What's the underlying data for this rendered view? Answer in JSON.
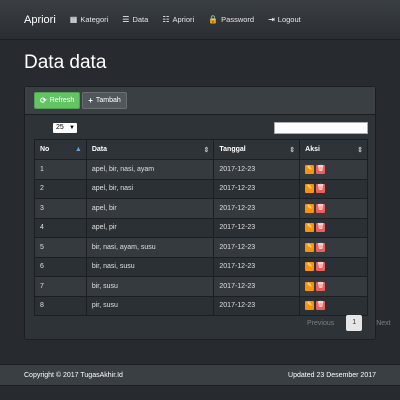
{
  "navbar": {
    "brand": "Apriori",
    "items": [
      {
        "label": "Kategori",
        "icon": "th-large-icon",
        "glyph": "▦"
      },
      {
        "label": "Data",
        "icon": "list-icon",
        "glyph": "☰"
      },
      {
        "label": "Apriori",
        "icon": "th-list-icon",
        "glyph": "☷"
      },
      {
        "label": "Password",
        "icon": "lock-icon",
        "glyph": "🔒"
      },
      {
        "label": "Logout",
        "icon": "logout-icon",
        "glyph": "⇥"
      }
    ]
  },
  "page": {
    "title": "Data data"
  },
  "toolbar": {
    "refresh_label": "Refresh",
    "tambah_label": "Tambah",
    "refresh_color": "#62c462"
  },
  "table": {
    "page_size": "25",
    "search_value": "",
    "headers": {
      "no": "No",
      "data": "Data",
      "tanggal": "Tanggal",
      "aksi": "Aksi"
    },
    "rows": [
      {
        "no": "1",
        "data": "apel, bir, nasi, ayam",
        "tanggal": "2017-12-23"
      },
      {
        "no": "2",
        "data": "apel, bir, nasi",
        "tanggal": "2017-12-23"
      },
      {
        "no": "3",
        "data": "apel, bir",
        "tanggal": "2017-12-23"
      },
      {
        "no": "4",
        "data": "apel, pir",
        "tanggal": "2017-12-23"
      },
      {
        "no": "5",
        "data": "bir, nasi, ayam, susu",
        "tanggal": "2017-12-23"
      },
      {
        "no": "6",
        "data": "bir, nasi, susu",
        "tanggal": "2017-12-23"
      },
      {
        "no": "7",
        "data": "bir, susu",
        "tanggal": "2017-12-23"
      },
      {
        "no": "8",
        "data": "pir, susu",
        "tanggal": "2017-12-23"
      }
    ]
  },
  "pagination": {
    "previous": "Previous",
    "current": "1",
    "next": "Next"
  },
  "footer": {
    "copyright": "Copyright © 2017 TugasAkhir.Id",
    "updated": "Updated 23 Desember 2017"
  },
  "colors": {
    "edit": "#f89406",
    "delete": "#ee5f5b",
    "background": "#272b30"
  }
}
